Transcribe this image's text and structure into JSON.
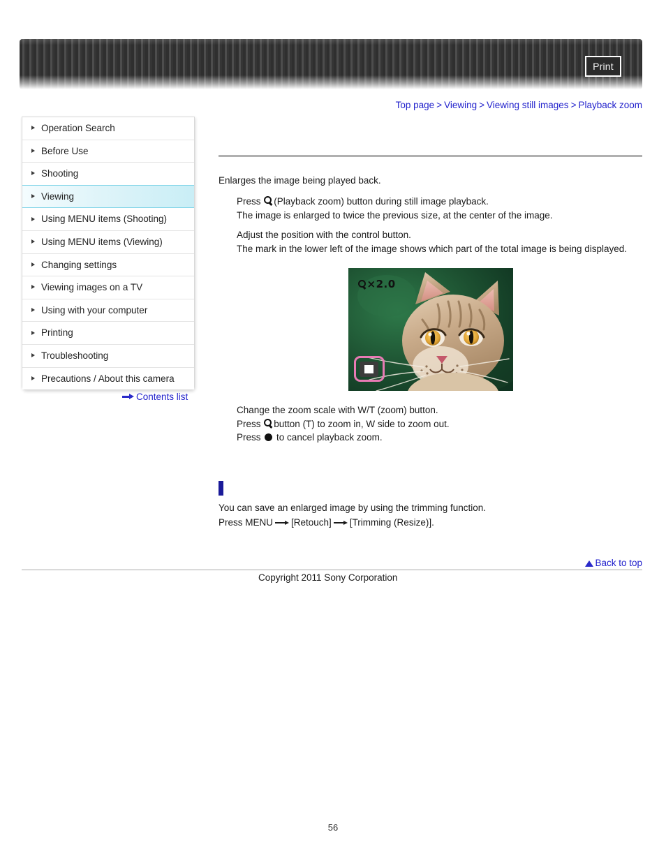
{
  "header": {
    "print_label": "Print"
  },
  "breadcrumb": {
    "items": [
      "Top page",
      "Viewing",
      "Viewing still images",
      "Playback zoom"
    ],
    "separator": ">"
  },
  "sidebar": {
    "items": [
      {
        "label": "Operation Search",
        "active": false
      },
      {
        "label": "Before Use",
        "active": false
      },
      {
        "label": "Shooting",
        "active": false
      },
      {
        "label": "Viewing",
        "active": true
      },
      {
        "label": "Using MENU items (Shooting)",
        "active": false
      },
      {
        "label": "Using MENU items (Viewing)",
        "active": false
      },
      {
        "label": "Changing settings",
        "active": false
      },
      {
        "label": "Viewing images on a TV",
        "active": false
      },
      {
        "label": "Using with your computer",
        "active": false
      },
      {
        "label": "Printing",
        "active": false
      },
      {
        "label": "Troubleshooting",
        "active": false
      },
      {
        "label": "Precautions / About this camera",
        "active": false
      }
    ],
    "contents_list_label": "Contents list",
    "contents_list_icon": "right-arrow-icon"
  },
  "main": {
    "lead": "Enlarges the image being played back.",
    "step1_before_icon": "Press",
    "step1_icon": "magnifier-icon",
    "step1_after_icon": "(Playback zoom) button during still image playback.",
    "step1_line2": "The image is enlarged to twice the previous size, at the center of the image.",
    "step2_line1": "Adjust the position with the control button.",
    "step2_line2": "The mark in the lower left of the image shows which part of the total image is being displayed.",
    "illustration": {
      "alt": "Camera screen showing enlarged cat photo",
      "zoom_label": "×2.0",
      "zoom_icon": "magnifier-icon",
      "position_marker": "playback-position-indicator",
      "marker_color": "#e87ab4"
    },
    "step3_line1": "Change the zoom scale with W/T (zoom) button.",
    "step3_line2_before": "Press",
    "step3_line2_icon": "magnifier-icon",
    "step3_line2_after": "button (T) to zoom in, W side to zoom out.",
    "step3_line3_before": "Press",
    "step3_line3_icon": "filled-circle-icon",
    "step3_line3_after": "to cancel playback zoom."
  },
  "note": {
    "marker": "blue-note-bar",
    "line1": "You can save an enlarged image by using the trimming function.",
    "line2_part1": "Press MENU",
    "line2_arrow1": "right-arrow-icon",
    "line2_part2": "[Retouch]",
    "line2_arrow2": "right-arrow-icon",
    "line2_part3": "[Trimming (Resize)]."
  },
  "footer": {
    "back_to_top_label": "Back to top",
    "back_to_top_icon": "triangle-up-icon",
    "copyright": "Copyright 2011 Sony Corporation",
    "page_number": "56"
  },
  "colors": {
    "link": "#2222cc",
    "active_nav": "#c9eef6",
    "note_marker": "#1a1a99",
    "rule": "#b0b0b0",
    "marker_pink": "#e87ab4"
  }
}
